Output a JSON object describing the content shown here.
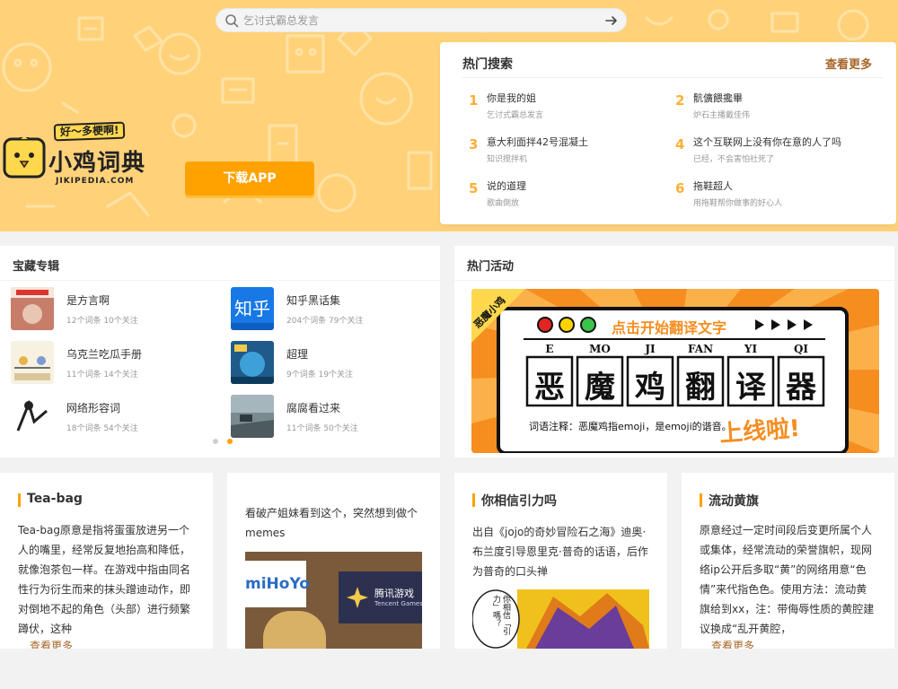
{
  "search": {
    "placeholder": "乞讨式霸总发言"
  },
  "logo": {
    "slogan": "好～多梗啊!",
    "name": "小鸡词典",
    "domain": "JIKIPEDIA.COM"
  },
  "download_label": "下载APP",
  "hot_search": {
    "title": "热门搜索",
    "more": "查看更多",
    "items": [
      {
        "rank": "1",
        "term": "你是我的姐",
        "sub": "乞讨式霸总发言"
      },
      {
        "rank": "2",
        "term": "骯儣餵攙畢",
        "sub": "炉石主播戴佳伟"
      },
      {
        "rank": "3",
        "term": "意大利面拌42号混凝土",
        "sub": "知识搅拌机"
      },
      {
        "rank": "4",
        "term": "这个互联网上没有你在意的人了吗",
        "sub": "已经，不会害怕社死了"
      },
      {
        "rank": "5",
        "term": "说的道理",
        "sub": "歌曲倒放"
      },
      {
        "rank": "6",
        "term": "拖鞋超人",
        "sub": "用拖鞋帮你做事的好心人"
      }
    ]
  },
  "collections": {
    "title": "宝藏专辑",
    "items": [
      {
        "name": "是方言啊",
        "meta": "12个词条  10个关注"
      },
      {
        "name": "知乎黑话集",
        "meta": "204个词条  79个关注"
      },
      {
        "name": "乌克兰吃瓜手册",
        "meta": "11个词条  14个关注"
      },
      {
        "name": "超理",
        "meta": "9个词条  19个关注"
      },
      {
        "name": "网络形容词",
        "meta": "18个词条  54个关注"
      },
      {
        "name": "腐腐看过来",
        "meta": "11个词条  50个关注"
      }
    ]
  },
  "activity": {
    "title": "热门活动",
    "banner": {
      "ribbon": "恶魔小鸡",
      "cta": "点击开始翻译文字",
      "pinyin": [
        "E",
        "MO",
        "JI",
        "FAN",
        "YI",
        "QI"
      ],
      "chars": [
        "恶",
        "魔",
        "鸡",
        "翻",
        "译",
        "器"
      ],
      "note": "词语注释：恶魔鸡指emoji，是emoji的谐音。",
      "launch": "上线啦!"
    }
  },
  "cards": [
    {
      "title": "Tea-bag",
      "text": "Tea-bag原意是指将蛋蛋放进另一个人的嘴里，经常反复地抬高和降低，就像泡茶包一样。在游戏中指由同名性行为衍生而来的抹头蹭迪动作，即对倒地不起的角色（头部）进行频繁蹲伏，这种",
      "more": "查看更多"
    },
    {
      "title": "",
      "text": "看破产姐妹看到这个，突然想到做个memes",
      "image": {
        "logo1": "miHoYo",
        "logo2": "腾讯游戏",
        "logo2_sub": "Tencent Games"
      }
    },
    {
      "title": "你相信引力吗",
      "text": "出自《jojo的奇妙冒险石之海》迪奥·布兰度引导恩里克·普奇的话语，后作为普奇的口头禅",
      "bubble": "你相信「引力」嗎？"
    },
    {
      "title": "流动黄旗",
      "text": "原意经过一定时间段后变更所属个人或集体，经常流动的荣誉旗帜，现网络ip公开后多取“黄”的网络用意“色情”来代指色色。使用方法：流动黄旗给到xx，注：带侮辱性质的黄腔建议换成“乱开黄腔，",
      "more": "查看更多"
    }
  ],
  "colors": {
    "hero_bg": "#ffd27a",
    "accent": "#ffa200",
    "rank": "#ffae36",
    "more_link": "#a6662a"
  }
}
